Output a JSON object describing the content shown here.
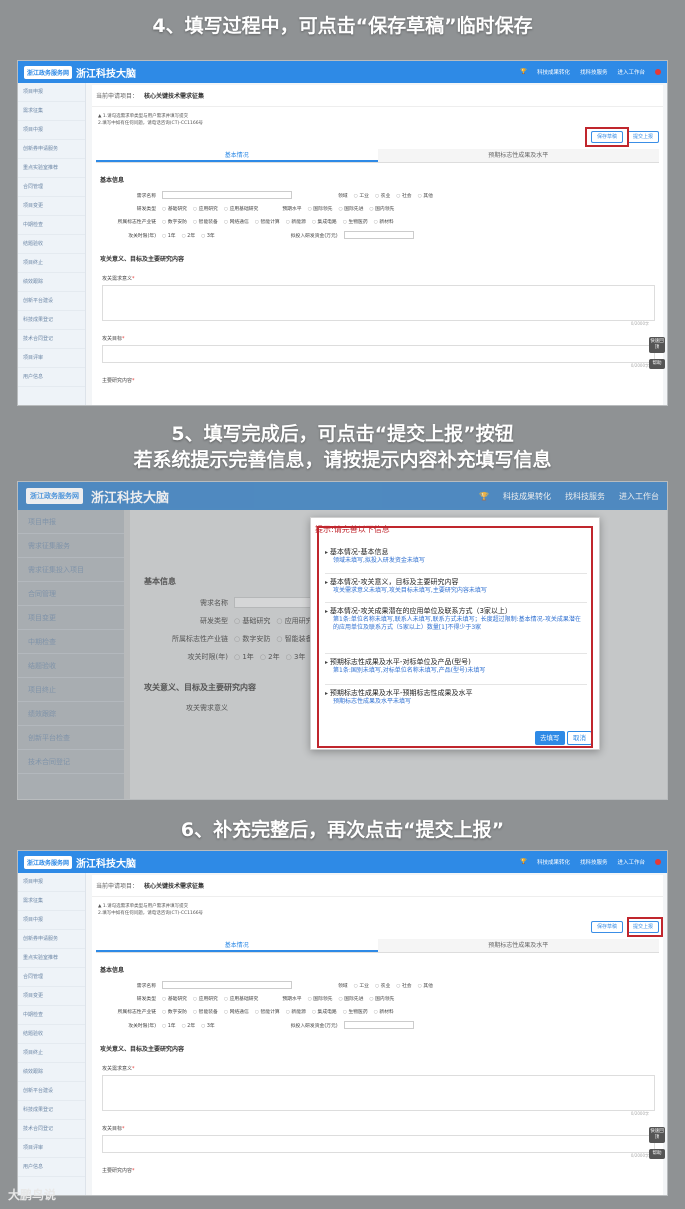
{
  "captions": {
    "step4": "4、填写过程中，可点击“保存草稿”临时保存",
    "step5_line1": "5、填写完成后，可点击“提交上报”按钮",
    "step5_line2": "若系统提示完善信息，请按提示内容补充填写信息",
    "step6": "6、补充完整后，再次点击“提交上报”"
  },
  "app": {
    "logo_text": "浙江政务服务网",
    "brand": "浙江科技大脑",
    "top_links": [
      "科技成果转化",
      "找科技服务",
      "进入工作台"
    ]
  },
  "sidebar": {
    "items": [
      "项目申报",
      "需求征集",
      "项目中报",
      "创新券申请服务",
      "重点实验室推荐",
      "合同管理",
      "项目变更",
      "中期检查",
      "结题验收",
      "项目终止",
      "绩效跟踪",
      "创新平台建设",
      "科技成果登记",
      "技术合同登记",
      "项目评审",
      "用户信息"
    ]
  },
  "sidebar2": {
    "items": [
      "项目申报",
      "需求征集服务",
      "需求征集投入项目",
      "合同管理",
      "项目变更",
      "中期检查",
      "结题验收",
      "项目终止",
      "绩效跟踪",
      "创新平台检查",
      "技术合同登记"
    ]
  },
  "form": {
    "breadcrumb_label": "当前申请项目：",
    "breadcrumb_value": "核心关键技术需求征集",
    "note1": "▲ 1.请勾选需求单类型与用户需求并填写提交",
    "note2": "2.填写中如有任何问题，请电话咨询(CT)-CC1166号",
    "save_draft": "保存草稿",
    "submit": "提交上报",
    "tab_basic": "基本情况",
    "tab_expected": "预期标志性成果及水平",
    "section_basic": "基本信息",
    "label_name": "需求名称",
    "label_area": "领域",
    "area_options": [
      "工业",
      "农业",
      "社会",
      "其他"
    ],
    "label_type": "研发类型",
    "type_options": [
      "基础研究",
      "应用研究",
      "应用基础研究"
    ],
    "label_level": "预期水平",
    "level_options": [
      "国际领先",
      "国际先进",
      "国内领先"
    ],
    "label_industry": "所属标志性产业链",
    "industry_options": [
      "数字安防",
      "智能装备",
      "网络通信",
      "智能计算",
      "新能源",
      "集成电路",
      "生物医药",
      "新材料",
      "新能源汽车",
      "现代纺织",
      "其他"
    ],
    "label_period": "攻关时限(年)",
    "period_options": [
      "1年",
      "2年",
      "3年"
    ],
    "label_invest": "拟投入研发资金(万元)",
    "section_goal": "攻关意义、目标及主要研究内容",
    "label_significance": "攻关需求意义",
    "label_target": "攻关目标",
    "label_content": "主要研究内容",
    "counter": "0/2000字",
    "float_1": "快速回顶",
    "float_2": "帮助"
  },
  "modal": {
    "title": "提示:请完善以下信息",
    "items": [
      {
        "h": "基本情况-基本信息",
        "d": "领域未填写,拟投入研发资金未填写"
      },
      {
        "h": "基本情况-攻关意义，目标及主要研究内容",
        "d": "攻关需求意义未填写,攻关目标未填写,主要研究内容未填写"
      },
      {
        "h": "基本情况-攻关成果潜在的应用单位及联系方式（3家以上）",
        "d": "第1条:单位名称未填写,联系人未填写,联系方式未填写；长度超过限制:基本情况-攻关成果潜在的应用单位及联系方式（5家以上）数量[1]不得少于3家"
      },
      {
        "h": "预期标志性成果及水平-对标单位及产品(型号)",
        "d": "第1条:国别未填写,对标单位名称未填写,产品(型号)未填写"
      },
      {
        "h": "预期标志性成果及水平-预期标志性成果及水平",
        "d": "预期标志性成果及水平未填写"
      }
    ],
    "btn_go": "去填写",
    "btn_cancel": "取消"
  },
  "watermark": "大鹏鸟说"
}
